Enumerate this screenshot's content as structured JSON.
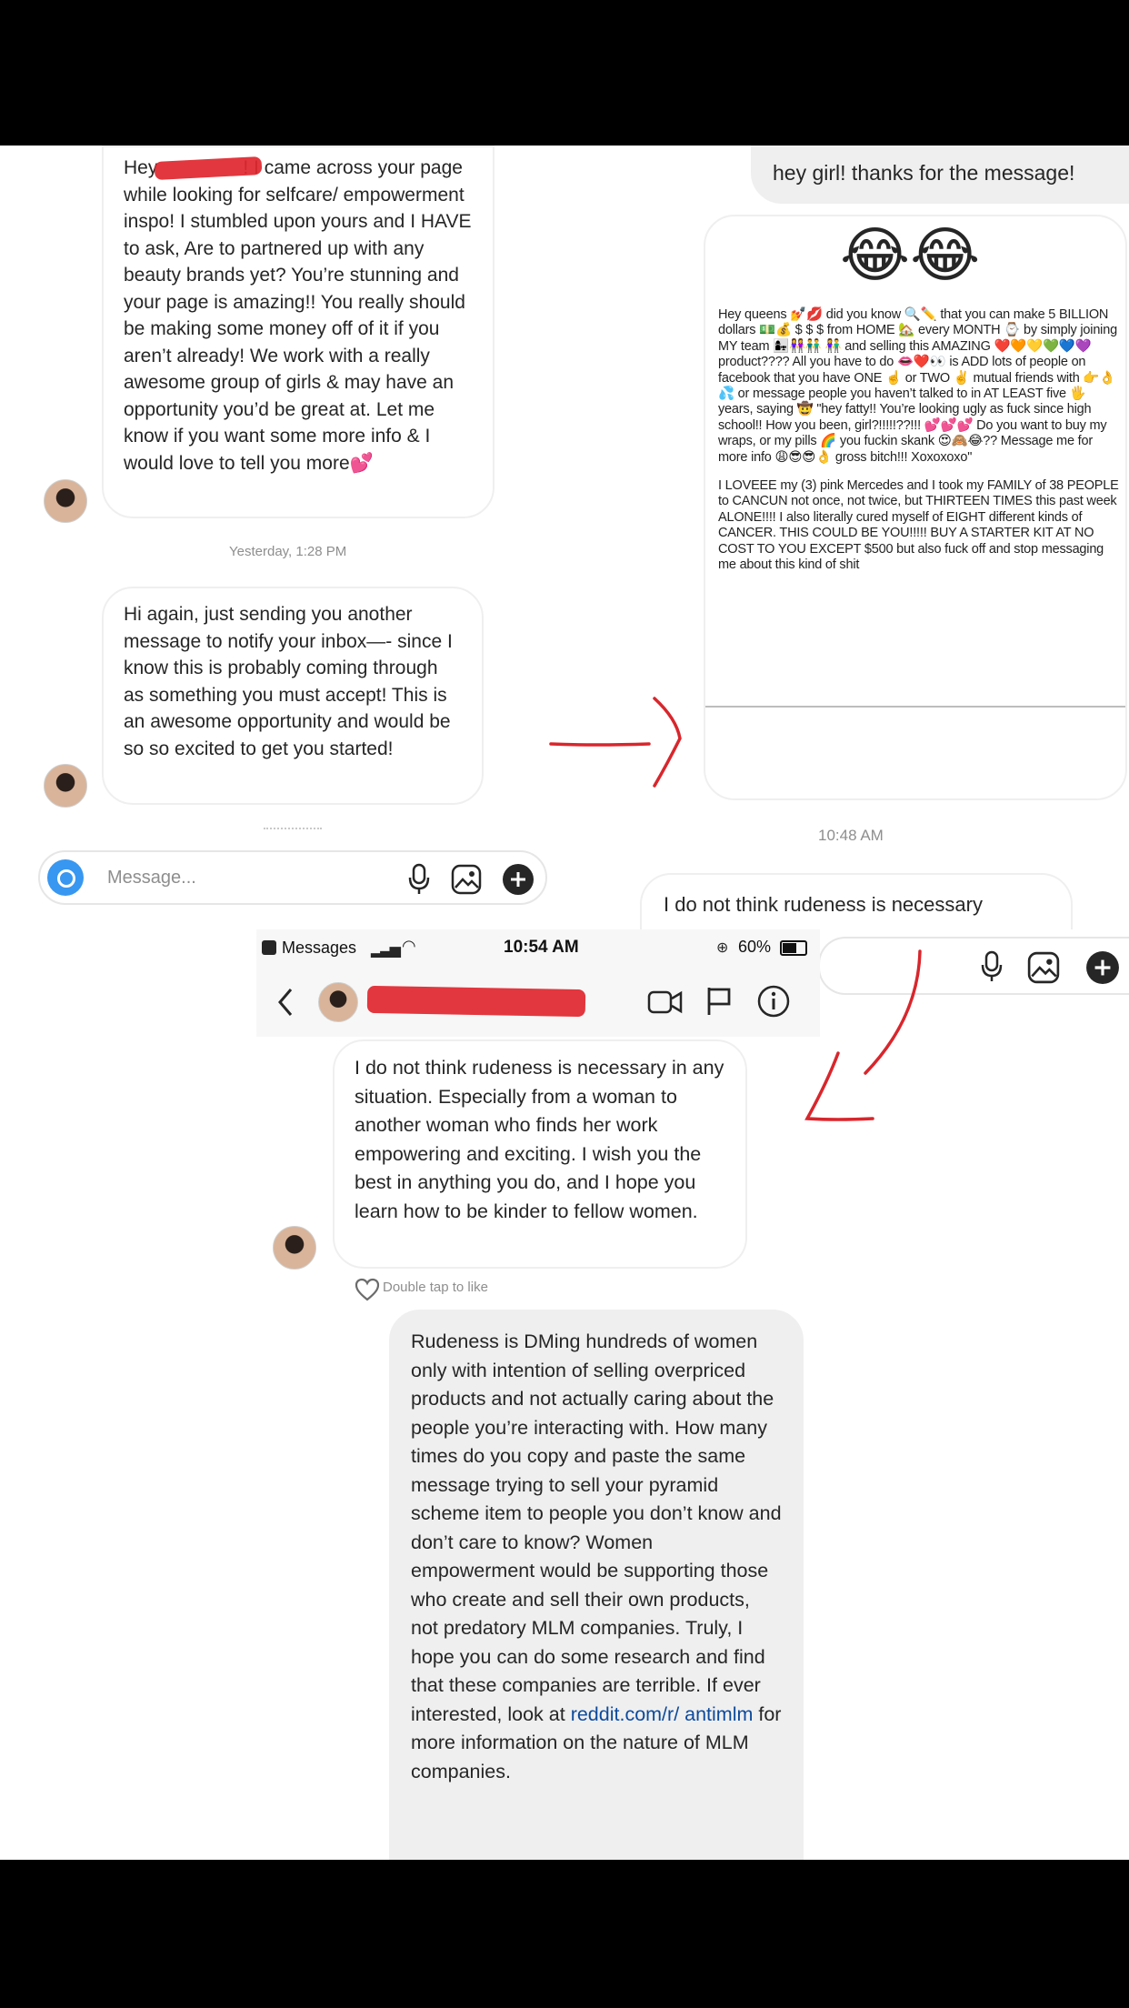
{
  "left_panel": {
    "msg1": {
      "pre": "Hey",
      "post": "! I came across your page while looking for selfcare/ empowerment inspo! I stumbled upon yours and I HAVE to ask,  Are to partnered up with any beauty brands yet? You’re stunning and your page is amazing!! You really should be making some money off of it if you aren’t already! We work with a really awesome group of girls & may have an opportunity you’d be great at. Let me know if you want some more info & I would love to tell you more💕"
    },
    "timestamp": "Yesterday, 1:28 PM",
    "msg2": "Hi again, just sending you another message to notify your inbox—- since I know this is probably coming through as something you must accept! This is an awesome opportunity and would be so so excited to get you started!",
    "composer_placeholder": "Message..."
  },
  "right_panel": {
    "reply": "hey girl! thanks for the message!",
    "emoji": "😂😂",
    "meme_para1": "Hey queens 💅💋 did you know 🔍✏️ that you can make 5 BILLION dollars 💵💰 $ $ $ from HOME 🏡 every MONTH ⌚ by simply joining MY team 👩‍👧👭👬 👫 and selling this AMAZING ❤️🧡💛💚💙💜 product???? All you have to do 👄❤️👀 is ADD lots of people on facebook that you have ONE ☝️ or TWO ✌️ mutual friends with 👉👌💦 or message people you haven’t talked to in AT LEAST five 🖐 years, saying 🤠 \"hey fatty!! You’re looking ugly as fuck since high school!! How you been, girl?!!!!!??!!! 💕💕💕 Do you want to buy my wraps, or my pills 🌈 you fuckin skank 😍🙈😂?? Message me for more info 😩😎😎👌 gross bitch!!! Xoxoxoxo\"",
    "meme_para2": "I LOVEEE my (3) pink Mercedes and I took my FAMILY of 38 PEOPLE to CANCUN not once, not twice, but THIRTEEN TIMES this past week ALONE!!!! I also literally cured myself of EIGHT different kinds of CANCER. THIS COULD BE YOU!!!!! BUY A STARTER KIT AT NO COST TO YOU EXCEPT $500 but also fuck off and stop messaging me about this kind of shit",
    "timestamp": "10:48 AM",
    "reply2": "I do not think rudeness is necessary"
  },
  "bottom_panel": {
    "status": {
      "carrier": "Messages",
      "time": "10:54 AM",
      "battery": "60%"
    },
    "msg": "I do not think rudeness is necessary in any situation. Especially from a woman to another woman who finds her work empowering and exciting. I wish you the best in anything you do, and I hope you learn how to be kinder to fellow women.",
    "like_hint": "Double tap to like",
    "reply_part1": "Rudeness is DMing hundreds of women only with intention of selling overpriced products and not actually caring about the people you’re interacting with. How many times do you copy and paste the same message trying to sell your pyramid scheme item to people you don’t know and don’t care to know? Women empowerment would be supporting those who create and sell their own products, not predatory MLM companies. Truly, I hope you can do some research and find that these companies are terrible. If ever interested, look at ",
    "reply_link": "reddit.com/r/ antimlm",
    "reply_part2": " for more information on the nature of MLM companies."
  }
}
